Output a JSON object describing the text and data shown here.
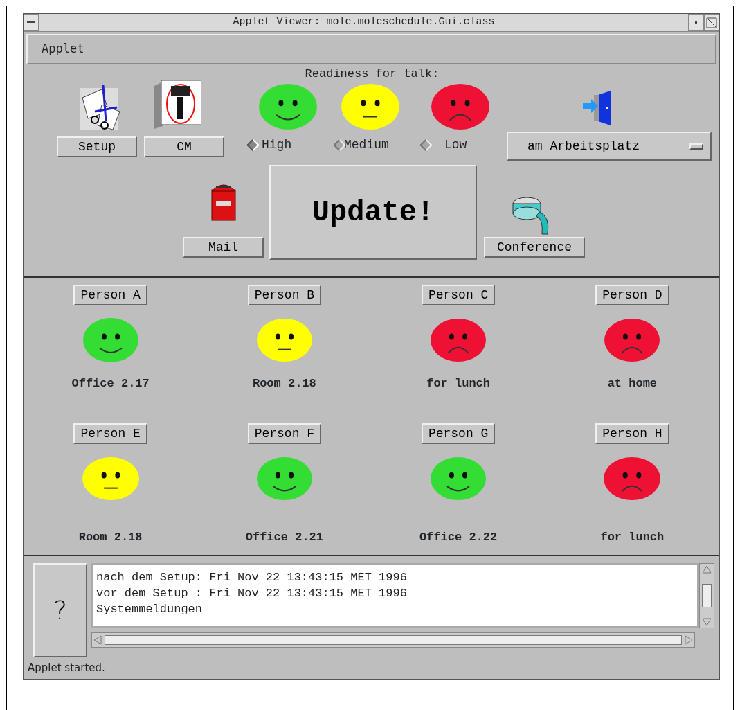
{
  "window": {
    "title": "Applet Viewer: mole.moleschedule.Gui.class"
  },
  "menu": [
    "Applet"
  ],
  "top_buttons": [
    "Setup",
    "CM"
  ],
  "readiness": {
    "title": "Readiness for talk:",
    "options": [
      {
        "label": "High",
        "kind": "happy",
        "selected": true
      },
      {
        "label": "Medium",
        "kind": "neutral",
        "selected": false
      },
      {
        "label": "Low",
        "kind": "sad",
        "selected": false
      }
    ]
  },
  "location_select": {
    "value": "am Arbeitsplatz"
  },
  "mail_button": "Mail",
  "update_button": "Update!",
  "conference_button": "Conference",
  "persons": [
    {
      "name": "Person A",
      "kind": "happy",
      "location": "Office 2.17"
    },
    {
      "name": "Person B",
      "kind": "neutral",
      "location": "Room 2.18"
    },
    {
      "name": "Person C",
      "kind": "sad",
      "location": "for lunch"
    },
    {
      "name": "Person D",
      "kind": "sad",
      "location": "at home"
    },
    {
      "name": "Person E",
      "kind": "neutral",
      "location": "Room 2.18"
    },
    {
      "name": "Person F",
      "kind": "happy",
      "location": "Office 2.21"
    },
    {
      "name": "Person G",
      "kind": "happy",
      "location": "Office 2.22"
    },
    {
      "name": "Person H",
      "kind": "sad",
      "location": "for lunch"
    }
  ],
  "help_button": "?",
  "messages": [
    "nach dem Setup: Fri Nov 22 13:43:15 MET 1996",
    "vor dem Setup : Fri Nov 22 13:43:15 MET 1996",
    "Systemmeldungen"
  ],
  "status_bar": "Applet started."
}
